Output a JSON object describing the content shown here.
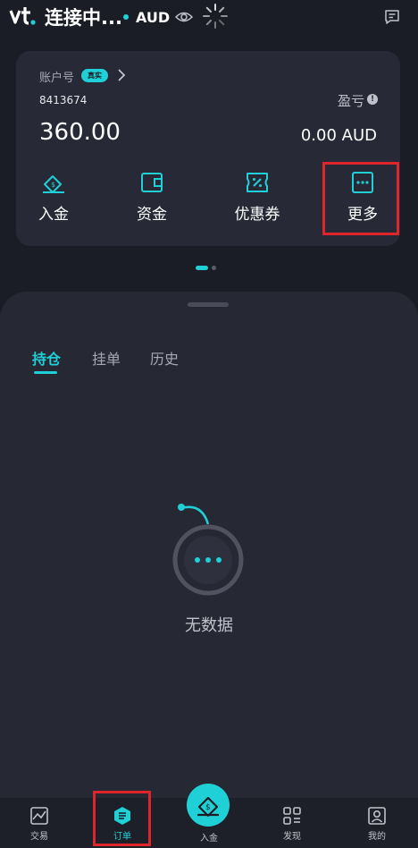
{
  "topbar": {
    "status_title": "连接中...",
    "currency": "AUD",
    "logo_icon": "vt-logo",
    "eye_icon": "eye-icon",
    "spinner_icon": "loading-spinner-icon",
    "message_icon": "message-icon"
  },
  "account": {
    "label": "账户号",
    "badge": "真实",
    "number": "8413674",
    "balance": "360.00",
    "pnl_label": "盈亏",
    "pnl_info": "!",
    "pnl_value": "0.00 AUD"
  },
  "actions": [
    {
      "label": "入金",
      "icon": "deposit-icon"
    },
    {
      "label": "资金",
      "icon": "wallet-icon"
    },
    {
      "label": "优惠券",
      "icon": "coupon-icon"
    },
    {
      "label": "更多",
      "icon": "more-icon"
    }
  ],
  "orders": {
    "tabs": [
      {
        "label": "持仓",
        "active": true
      },
      {
        "label": "挂单",
        "active": false
      },
      {
        "label": "历史",
        "active": false
      }
    ],
    "empty_text": "无数据"
  },
  "bottom_nav": [
    {
      "label": "交易",
      "icon": "chart-icon"
    },
    {
      "label": "订单",
      "icon": "order-icon",
      "active": true
    },
    {
      "label": "入金",
      "icon": "deposit-icon",
      "center": true
    },
    {
      "label": "发现",
      "icon": "discover-icon"
    },
    {
      "label": "我的",
      "icon": "profile-icon"
    }
  ],
  "colors": {
    "accent": "#1fd1d6",
    "background": "#1b1d26",
    "card": "#272a36",
    "highlight": "#e0242b"
  }
}
